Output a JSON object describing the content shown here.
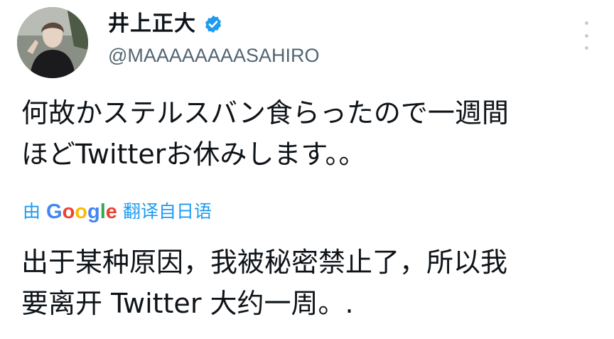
{
  "user": {
    "display_name": "井上正大",
    "handle": "@MAAAAAAAASAHIRO",
    "verified": true
  },
  "tweet": {
    "lines": [
      "何故かステルスバン食らったので一週間",
      "ほどTwitterお休みします。。"
    ]
  },
  "translation": {
    "prefix": "由",
    "provider_letters": [
      "G",
      "o",
      "o",
      "g",
      "l",
      "e"
    ],
    "suffix": "翻译自日语",
    "lines": [
      "出于某种原因，我被秘密禁止了，所以我",
      "要离开 Twitter 大约一周。."
    ]
  },
  "icons": {
    "verified": "verified-badge-icon",
    "more": "more-vertical-icon"
  },
  "colors": {
    "link": "#1d9bf0",
    "verified": "#1d9bf0",
    "text": "#0f1419",
    "secondary": "#536471"
  }
}
